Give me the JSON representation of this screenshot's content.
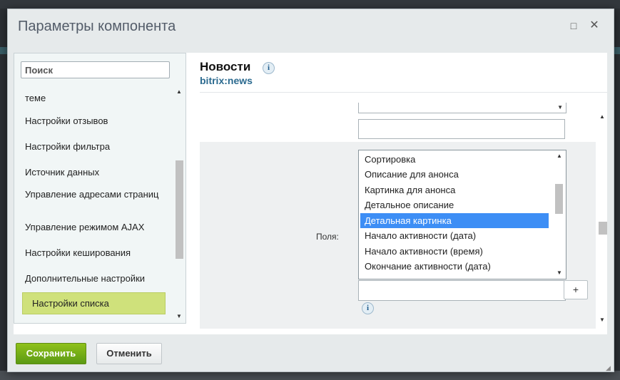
{
  "dialog": {
    "title": "Параметры компонента",
    "maximize_icon": "maximize-icon",
    "close_icon": "close-icon"
  },
  "search": {
    "placeholder": "Поиск"
  },
  "sidebar": {
    "items": [
      {
        "label": "теме"
      },
      {
        "label": "Настройки отзывов"
      },
      {
        "label": "Настройки фильтра"
      },
      {
        "label": "Источник данных"
      },
      {
        "label": "Управление адресами страниц"
      },
      {
        "label": "Управление режимом AJAX"
      },
      {
        "label": "Настройки кеширования"
      },
      {
        "label": "Дополнительные настройки"
      },
      {
        "label": "Настройки списка",
        "active": true
      }
    ]
  },
  "component": {
    "name": "Новости",
    "code": "bitrix:news"
  },
  "fields": {
    "label": "Поля:",
    "options": [
      {
        "label": "Сортировка"
      },
      {
        "label": "Описание для анонса"
      },
      {
        "label": "Картинка для анонса"
      },
      {
        "label": "Детальное описание"
      },
      {
        "label": "Детальная картинка",
        "selected": true
      },
      {
        "label": "Начало активности (дата)"
      },
      {
        "label": "Начало активности (время)"
      },
      {
        "label": "Окончание активности (дата)"
      }
    ],
    "add_input_value": "",
    "add_button": "+"
  },
  "footer": {
    "save_label": "Сохранить",
    "cancel_label": "Отменить"
  },
  "colors": {
    "active_item_bg": "#cfe17b",
    "selected_option_bg": "#3d8ef5",
    "save_button": "#6fae16"
  }
}
